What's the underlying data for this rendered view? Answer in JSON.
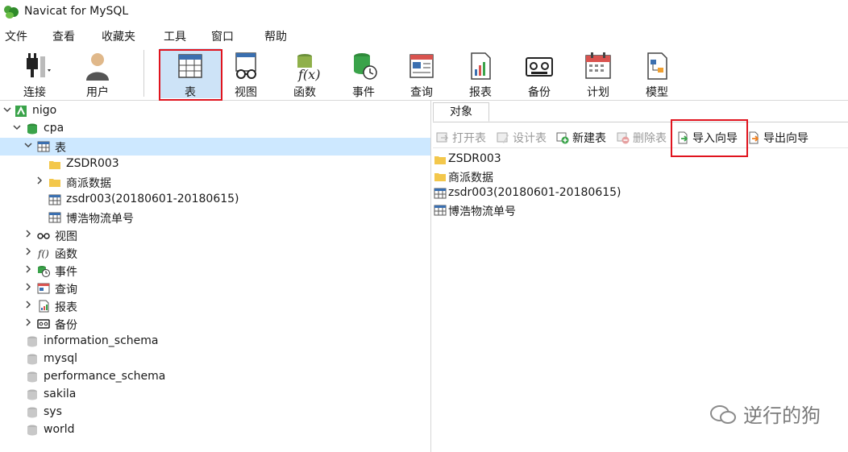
{
  "window": {
    "title": "Navicat for MySQL"
  },
  "menu": [
    "文件",
    "查看",
    "收藏夹",
    "工具",
    "窗口",
    "帮助"
  ],
  "toolbar": [
    {
      "label": "连接",
      "icon": "plug-icon"
    },
    {
      "label": "用户",
      "icon": "user-icon"
    },
    {
      "label": "表",
      "icon": "table-icon",
      "active": true
    },
    {
      "label": "视图",
      "icon": "view-icon"
    },
    {
      "label": "函数",
      "icon": "function-icon"
    },
    {
      "label": "事件",
      "icon": "event-icon"
    },
    {
      "label": "查询",
      "icon": "query-icon"
    },
    {
      "label": "报表",
      "icon": "report-icon"
    },
    {
      "label": "备份",
      "icon": "backup-icon"
    },
    {
      "label": "计划",
      "icon": "calendar-icon"
    },
    {
      "label": "模型",
      "icon": "model-icon"
    }
  ],
  "tree": [
    {
      "text": "nigo",
      "icon": "connection-icon",
      "expanded": true
    },
    {
      "text": "cpa",
      "icon": "database-icon",
      "expanded": true
    },
    {
      "text": "表",
      "icon": "table-icon",
      "expanded": true,
      "selected": true
    },
    {
      "text": "ZSDR003",
      "icon": "folder-icon"
    },
    {
      "text": "商派数据",
      "icon": "folder-icon",
      "expanded": false
    },
    {
      "text": "zsdr003(20180601-20180615)",
      "icon": "table-icon"
    },
    {
      "text": "博浩物流单号",
      "icon": "table-icon"
    },
    {
      "text": "视图",
      "icon": "view-icon",
      "expanded": false
    },
    {
      "text": "函数",
      "icon": "function-icon",
      "expanded": false
    },
    {
      "text": "事件",
      "icon": "event-icon",
      "expanded": false
    },
    {
      "text": "查询",
      "icon": "query-icon",
      "expanded": false
    },
    {
      "text": "报表",
      "icon": "report-icon",
      "expanded": false
    },
    {
      "text": "备份",
      "icon": "backup-icon",
      "expanded": false
    },
    {
      "text": "information_schema",
      "icon": "database-gray-icon"
    },
    {
      "text": "mysql",
      "icon": "database-gray-icon"
    },
    {
      "text": "performance_schema",
      "icon": "database-gray-icon"
    },
    {
      "text": "sakila",
      "icon": "database-gray-icon"
    },
    {
      "text": "sys",
      "icon": "database-gray-icon"
    },
    {
      "text": "world",
      "icon": "database-gray-icon"
    }
  ],
  "tab": "对象",
  "object_toolbar": [
    {
      "label": "打开表",
      "icon": "open-table-icon",
      "enabled": false
    },
    {
      "label": "设计表",
      "icon": "design-table-icon",
      "enabled": false
    },
    {
      "label": "新建表",
      "icon": "new-table-icon",
      "enabled": true
    },
    {
      "label": "删除表",
      "icon": "delete-table-icon",
      "enabled": false
    },
    {
      "label": "导入向导",
      "icon": "import-wizard-icon",
      "enabled": true
    },
    {
      "label": "导出向导",
      "icon": "export-wizard-icon",
      "enabled": true
    }
  ],
  "objects": [
    {
      "text": "ZSDR003",
      "icon": "folder-icon"
    },
    {
      "text": "商派数据",
      "icon": "folder-icon"
    },
    {
      "text": "zsdr003(20180601-20180615)",
      "icon": "table-icon"
    },
    {
      "text": "博浩物流单号",
      "icon": "table-icon"
    }
  ],
  "watermark": "逆行的狗",
  "colors": {
    "selection": "#cde8ff",
    "highlight_box": "#e0141e",
    "db_green": "#3aa34a",
    "folder": "#f3c74b"
  }
}
